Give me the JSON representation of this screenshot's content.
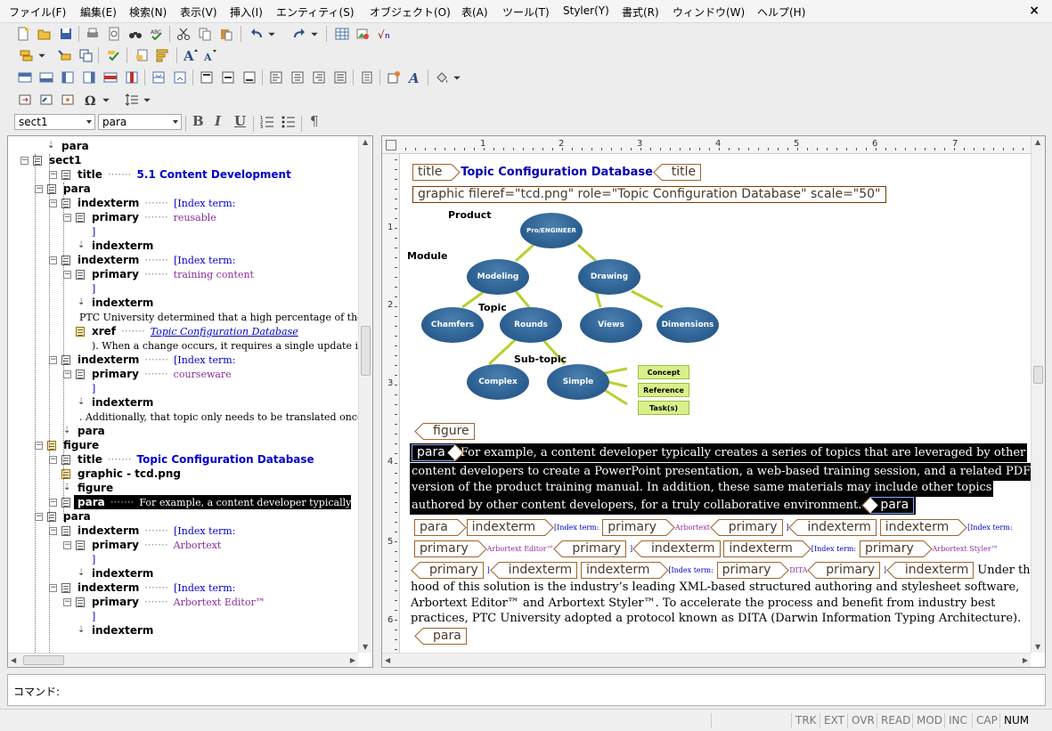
{
  "menu": [
    "ファイル(F)",
    "編集(E)",
    "検索(N)",
    "表示(V)",
    "挿入(I)",
    "エンティティ(S)",
    "オブジェクト(O)",
    "表(A)",
    "ツール(T)",
    "Styler(Y)",
    "書式(R)",
    "ウィンドウ(W)",
    "ヘルプ(H)"
  ],
  "window": {
    "close": "×"
  },
  "toolbar": {
    "element_combo": "sect1",
    "style_combo": "para",
    "bold": "B",
    "italic": "I",
    "underline": "U",
    "pilcrow": "¶"
  },
  "tree": [
    {
      "tag": "para",
      "value": ""
    },
    {
      "tag": "sect1",
      "value": ""
    },
    {
      "tag": "title",
      "value": "5.1 Content Development"
    },
    {
      "tag": "para",
      "value": ""
    },
    {
      "tag": "indexterm",
      "value": "[Index term:"
    },
    {
      "tag": "primary",
      "value": "reusable"
    },
    {
      "tag": "",
      "value": "]"
    },
    {
      "tag": "indexterm",
      "value": ""
    },
    {
      "tag": "indexterm",
      "value": "[Index term:"
    },
    {
      "tag": "primary",
      "value": "training content"
    },
    {
      "tag": "",
      "value": "]"
    },
    {
      "tag": "indexterm",
      "value": ""
    },
    {
      "tag": "",
      "value": "PTC University determined that a high percentage of the:"
    },
    {
      "tag": "xref",
      "value": "Topic Configuration Database"
    },
    {
      "tag": "",
      "value": "). When a change occurs, it requires a single update in th"
    },
    {
      "tag": "indexterm",
      "value": "[Index term:"
    },
    {
      "tag": "primary",
      "value": "courseware"
    },
    {
      "tag": "",
      "value": "]"
    },
    {
      "tag": "indexterm",
      "value": ""
    },
    {
      "tag": "",
      "value": ". Additionally, that topic only needs to be translated once"
    },
    {
      "tag": "para",
      "value": ""
    },
    {
      "tag": "figure",
      "value": ""
    },
    {
      "tag": "title",
      "value": "Topic Configuration Database"
    },
    {
      "tag": "graphic - tcd.png",
      "value": ""
    },
    {
      "tag": "figure",
      "value": ""
    },
    {
      "tag": "para",
      "value": "For example, a content developer typically cre"
    },
    {
      "tag": "para",
      "value": ""
    },
    {
      "tag": "indexterm",
      "value": "[Index term:"
    },
    {
      "tag": "primary",
      "value": "Arbortext"
    },
    {
      "tag": "",
      "value": "]"
    },
    {
      "tag": "indexterm",
      "value": ""
    },
    {
      "tag": "indexterm",
      "value": "[Index term:"
    },
    {
      "tag": "primary",
      "value": "Arbortext Editor™"
    },
    {
      "tag": "",
      "value": "]"
    },
    {
      "tag": "indexterm",
      "value": ""
    }
  ],
  "ruler": {
    "marks": [
      "1",
      "2",
      "3",
      "4",
      "5",
      "6",
      "7"
    ],
    "vmarks": [
      "1",
      "2",
      "3",
      "4",
      "5",
      "6"
    ]
  },
  "doc": {
    "title_tag": "title",
    "title_text": "Topic Configuration Database",
    "title_end": "title",
    "graphic": "graphic fileref=\"tcd.png\" role=\"Topic Configuration Database\" scale=\"50\"",
    "diagram": {
      "product_label": "Product",
      "module_label": "Module",
      "topic_label": "Topic",
      "subtopic_label": "Sub-topic",
      "root": "Pro/ENGINEER",
      "modeling": "Modeling",
      "drawing": "Drawing",
      "chamfers": "Chamfers",
      "rounds": "Rounds",
      "views": "Views",
      "dimensions": "Dimensions",
      "complex": "Complex",
      "simple": "Simple",
      "concept": "Concept",
      "reference": "Reference",
      "tasks": "Task(s)"
    },
    "figure_end": "figure",
    "para_tag": "para",
    "para_lines": [
      "For example, a content developer typically creates a series of topics that are leveraged by other",
      "content developers to create a PowerPoint presentation, a web-based training session, and a related PDF",
      "version of the product training manual. In addition, these same materials may include other topics",
      "authored by other content developers, for a truly collaborative environment."
    ],
    "para_end": "para",
    "row1": {
      "para": "para",
      "indexterm": "indexterm",
      "idxlabel": "[Index term:",
      "primary": "primary",
      "value": "Arbortext",
      "close": "]"
    },
    "row2": {
      "primary": "primary",
      "value": "Arbortext Editor™",
      "close": "]",
      "indexterm": "indexterm",
      "idxlabel": "[Index term:",
      "value2": "Arbortext Styler™"
    },
    "row3": {
      "primary": "primary",
      "close": "]",
      "indexterm": "indexterm",
      "idxlabel": "[Index term:",
      "value": "DITA",
      "trail": "Under the"
    },
    "body_lines": [
      "hood of this solution is the industry’s leading XML-based structured authoring and stylesheet software,",
      "Arbortext Editor™ and Arbortext Styler™. To accelerate the process and benefit from industry best",
      "practices, PTC University adopted a protocol known as DITA (Darwin Information Typing Architecture)."
    ],
    "last_para": "para"
  },
  "command": {
    "label": "コマンド:"
  },
  "status": [
    "TRK",
    "EXT",
    "OVR",
    "READ",
    "MOD",
    "INC",
    "CAP",
    "NUM"
  ]
}
